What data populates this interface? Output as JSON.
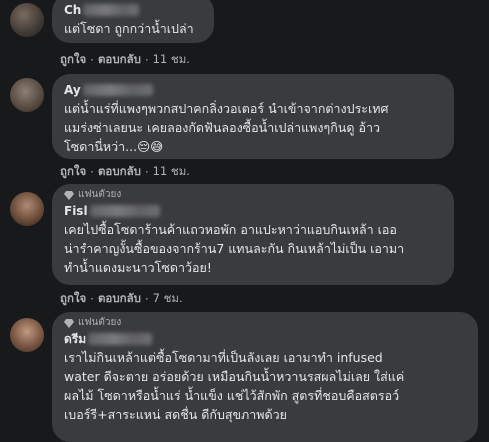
{
  "comments": [
    {
      "name": "Ch",
      "badge": "",
      "text": "แต่โซดา ถูกกว่าน้ำเปล่า",
      "like": "ถูกใจ",
      "reply": "ตอบกลับ",
      "time": "11 ชม."
    },
    {
      "name": "Ay",
      "badge": "",
      "text": "แต่น้ำแร่ที่แพงๆพวกสปาคกลิ่งวอเตอร์ นำเข้าจากต่างประเทศ\nแมร่งซ่าเลยนะ เคยลองกัดฟันลองซื้อน้ำเปล่าแพงๆกินดู อ้าว\nโซดานี่หว่า...😔😅",
      "like": "ถูกใจ",
      "reply": "ตอบกลับ",
      "time": "11 ชม."
    },
    {
      "name": "Fisl",
      "badge": "แฟนตัวยง",
      "text": "เคยไปซื้อโซดาร้านค้าแถวหอพัก อาแปะหาว่าแอบกินเหล้า เออ\nน่ารำคาญงั้นซื้อของจากร้าน7 แทนละกัน กินเหล้าไม่เป็น เอามา\nทำน้ำแดงมะนาวโซดาว้อย!",
      "like": "ถูกใจ",
      "reply": "ตอบกลับ",
      "time": "7 ชม."
    },
    {
      "name": "ดรีม",
      "badge": "แฟนตัวยง",
      "text": "เราไม่กินเหล้าแต่ซื้อโซดามาที่เป็นลังเลย เอามาทำ infused\nwater ดีจะตาย อร่อยด้วย เหมือนกินน้ำหวานรสผลไม่เลย ใส่แค่\nผลไม้ โซดาหรือน้ำแร่ น้ำแข็ง แช่ไว้สักพัก สูตรที่ชอบคือสตรอว์\nเบอร์รี+สาระแหน่ สดชื่น ดีกับสุขภาพด้วย",
      "like": "",
      "reply": "",
      "time": ""
    }
  ],
  "separator": "·"
}
